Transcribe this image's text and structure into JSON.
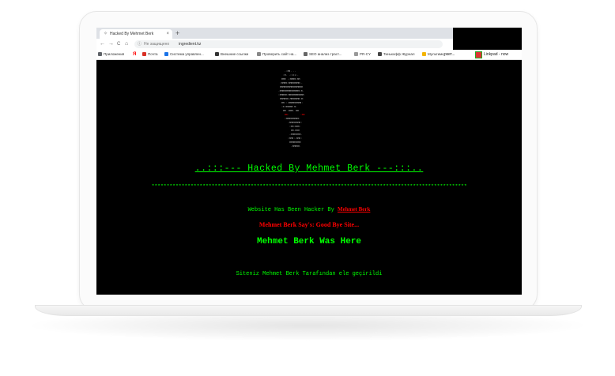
{
  "browser": {
    "tab_title": "Hacked By Mehmet Berk",
    "tab_close": "×",
    "new_tab": "+",
    "nav": {
      "back": "←",
      "forward": "→",
      "reload": "C",
      "home": "⌂"
    },
    "omnibox": {
      "security_text": "Не защищено",
      "url": "ingredient.kz"
    },
    "bookmarks": [
      {
        "label": "Приложения",
        "color": "#5f6368"
      },
      {
        "label": "Я",
        "color": "#ff0000"
      },
      {
        "label": "Почта",
        "color": "#d93025"
      },
      {
        "label": "Система управлен...",
        "color": "#1a73e8"
      },
      {
        "label": "Внешние ссылки",
        "color": "#333333"
      },
      {
        "label": "Проверить сайт на...",
        "color": "#888888"
      },
      {
        "label": "SEO анализ траст...",
        "color": "#666666"
      },
      {
        "label": "PR-CY",
        "color": "#999999"
      },
      {
        "label": "Тинькофф Журнал",
        "color": "#444444"
      },
      {
        "label": "Мультимеди",
        "color": "#f4b400"
      }
    ],
    "overlay": {
      "partial_left": "ркет...",
      "linkpad": "Linkpad - now"
    }
  },
  "page": {
    "heading": "..:::--- Hacked By Mehmet Berk ---:::..",
    "stars": "*********************************************************************************************************",
    "line1_prefix": "Website Has Been Hacker By",
    "line1_link": "Mehmet Berk",
    "line2": "Mehmet Berk Say's: Good Bye Site...",
    "line3": "Mehmet Berk Was Here",
    "line4": "Siteniz Mehmet Berk Tarafından ele geçirildi"
  },
  "colors": {
    "page_bg": "#000000",
    "hacker_green": "#00ff00",
    "hacker_red": "#ff0000"
  }
}
